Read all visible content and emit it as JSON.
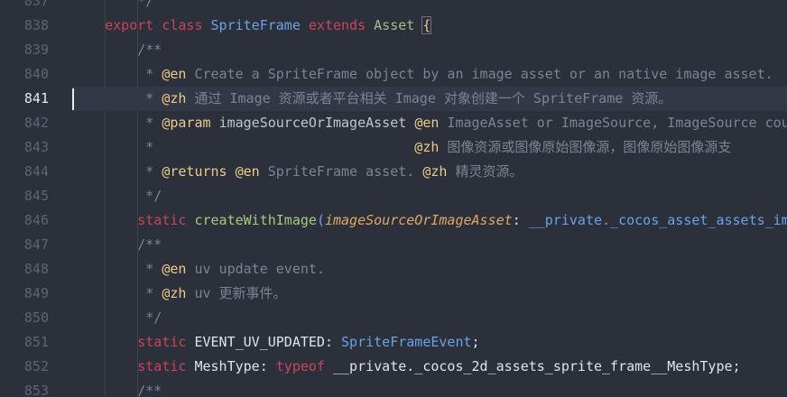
{
  "editor": {
    "active_line": 841,
    "lines": [
      {
        "n": "837",
        "segs": [
          {
            "t": "        */",
            "c": "c-comment"
          }
        ]
      },
      {
        "n": "838",
        "segs": [
          {
            "t": "    ",
            "c": "c-plain"
          },
          {
            "t": "export",
            "c": "c-kw"
          },
          {
            "t": " ",
            "c": "c-plain"
          },
          {
            "t": "class",
            "c": "c-kw"
          },
          {
            "t": " ",
            "c": "c-plain"
          },
          {
            "t": "SpriteFrame",
            "c": "c-type"
          },
          {
            "t": " ",
            "c": "c-plain"
          },
          {
            "t": "extends",
            "c": "c-kw"
          },
          {
            "t": " ",
            "c": "c-plain"
          },
          {
            "t": "Asset",
            "c": "c-asset"
          },
          {
            "t": " ",
            "c": "c-plain"
          },
          {
            "t": "{",
            "c": "c-brace"
          }
        ]
      },
      {
        "n": "839",
        "segs": [
          {
            "t": "        /**",
            "c": "c-comment"
          }
        ]
      },
      {
        "n": "840",
        "segs": [
          {
            "t": "         * ",
            "c": "c-comment"
          },
          {
            "t": "@en",
            "c": "c-tag"
          },
          {
            "t": " Create a SpriteFrame object by an image asset or an native image asset.",
            "c": "c-comment"
          }
        ]
      },
      {
        "n": "841",
        "segs": [
          {
            "t": "         * ",
            "c": "c-comment"
          },
          {
            "t": "@zh",
            "c": "c-tag"
          },
          {
            "t": " 通过 Image 资源或者平台相关 Image 对象创建一个 SpriteFrame 资源。",
            "c": "c-comment"
          }
        ]
      },
      {
        "n": "842",
        "segs": [
          {
            "t": "         * ",
            "c": "c-comment"
          },
          {
            "t": "@param",
            "c": "c-tag"
          },
          {
            "t": " ",
            "c": "c-comment"
          },
          {
            "t": "imageSourceOrImageAsset",
            "c": "c-ident"
          },
          {
            "t": " ",
            "c": "c-comment"
          },
          {
            "t": "@en",
            "c": "c-tag"
          },
          {
            "t": " ImageAsset or ImageSource, ImageSource could",
            "c": "c-comment"
          }
        ]
      },
      {
        "n": "843",
        "segs": [
          {
            "t": "         *                                ",
            "c": "c-comment"
          },
          {
            "t": "@zh",
            "c": "c-tag"
          },
          {
            "t": " 图像资源或图像原始图像源，图像原始图像源支",
            "c": "c-comment"
          }
        ]
      },
      {
        "n": "844",
        "segs": [
          {
            "t": "         * ",
            "c": "c-comment"
          },
          {
            "t": "@returns",
            "c": "c-tag"
          },
          {
            "t": " ",
            "c": "c-comment"
          },
          {
            "t": "@en",
            "c": "c-tag"
          },
          {
            "t": " SpriteFrame asset. ",
            "c": "c-comment"
          },
          {
            "t": "@zh",
            "c": "c-tag"
          },
          {
            "t": " 精灵资源。",
            "c": "c-comment"
          }
        ]
      },
      {
        "n": "845",
        "segs": [
          {
            "t": "         */",
            "c": "c-comment"
          }
        ]
      },
      {
        "n": "846",
        "segs": [
          {
            "t": "        ",
            "c": "c-plain"
          },
          {
            "t": "static",
            "c": "c-kw"
          },
          {
            "t": " ",
            "c": "c-plain"
          },
          {
            "t": "createWithImage",
            "c": "c-func"
          },
          {
            "t": "(",
            "c": "c-paren"
          },
          {
            "t": "imageSourceOrImageAsset",
            "c": "c-param"
          },
          {
            "t": ": ",
            "c": "c-plain"
          },
          {
            "t": "__private._cocos_asset_assets_image",
            "c": "c-type"
          }
        ]
      },
      {
        "n": "847",
        "segs": [
          {
            "t": "        /**",
            "c": "c-comment"
          }
        ]
      },
      {
        "n": "848",
        "segs": [
          {
            "t": "         * ",
            "c": "c-comment"
          },
          {
            "t": "@en",
            "c": "c-tag"
          },
          {
            "t": " uv update event.",
            "c": "c-comment"
          }
        ]
      },
      {
        "n": "849",
        "segs": [
          {
            "t": "         * ",
            "c": "c-comment"
          },
          {
            "t": "@zh",
            "c": "c-tag"
          },
          {
            "t": " uv 更新事件。",
            "c": "c-comment"
          }
        ]
      },
      {
        "n": "850",
        "segs": [
          {
            "t": "         */",
            "c": "c-comment"
          }
        ]
      },
      {
        "n": "851",
        "segs": [
          {
            "t": "        ",
            "c": "c-plain"
          },
          {
            "t": "static",
            "c": "c-kw"
          },
          {
            "t": " EVENT_UV_UPDATED: ",
            "c": "c-plain"
          },
          {
            "t": "SpriteFrameEvent",
            "c": "c-type"
          },
          {
            "t": ";",
            "c": "c-plain"
          }
        ]
      },
      {
        "n": "852",
        "segs": [
          {
            "t": "        ",
            "c": "c-plain"
          },
          {
            "t": "static",
            "c": "c-kw"
          },
          {
            "t": " MeshType: ",
            "c": "c-plain"
          },
          {
            "t": "typeof",
            "c": "c-kw"
          },
          {
            "t": " __private._cocos_2d_assets_sprite_frame__MeshType;",
            "c": "c-plain"
          }
        ]
      },
      {
        "n": "853",
        "segs": [
          {
            "t": "        /**",
            "c": "c-comment"
          }
        ]
      }
    ]
  }
}
